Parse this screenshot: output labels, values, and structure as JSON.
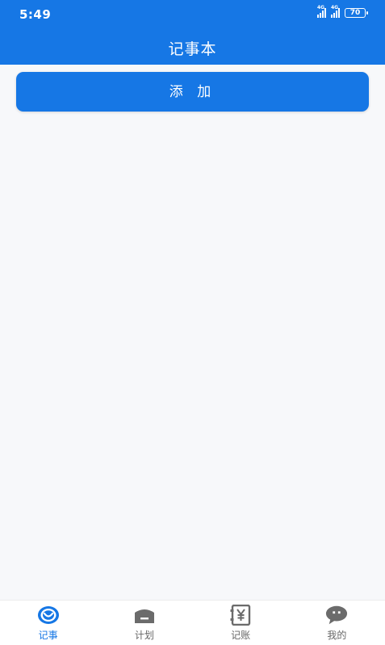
{
  "status_bar": {
    "time": "5:49",
    "network_1": "4G",
    "network_2": "4G",
    "battery": "70"
  },
  "header": {
    "title": "记事本"
  },
  "main": {
    "add_label": "添 加"
  },
  "tabbar": {
    "items": [
      {
        "label": "记事",
        "icon": "notebook-icon",
        "active": true
      },
      {
        "label": "计划",
        "icon": "plan-icon",
        "active": false
      },
      {
        "label": "记账",
        "icon": "ledger-yuan-icon",
        "active": false
      },
      {
        "label": "我的",
        "icon": "chat-bubble-icon",
        "active": false
      }
    ]
  },
  "colors": {
    "primary": "#1677e5",
    "background": "#f7f8fa",
    "inactive_icon": "#6b6b6b"
  }
}
